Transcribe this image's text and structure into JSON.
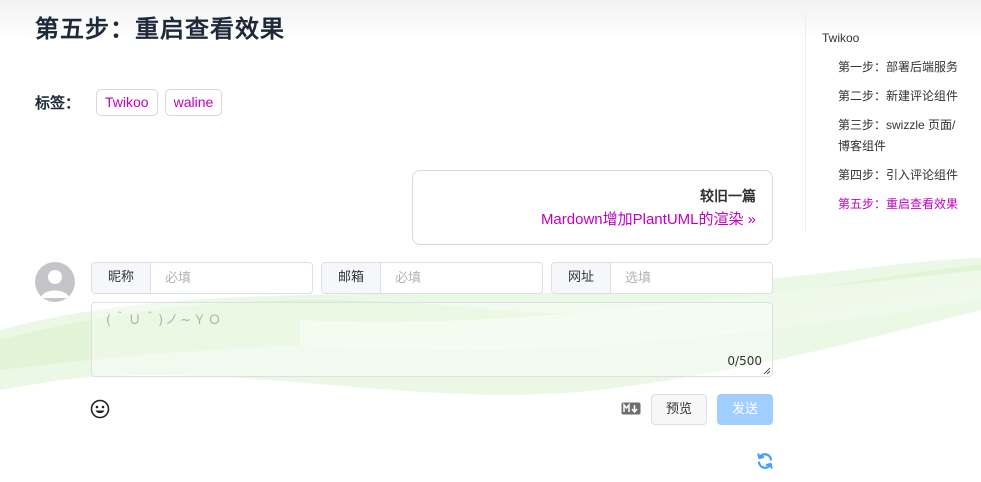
{
  "colors": {
    "accent": "#c000c0",
    "send_button": "#a0cfff",
    "refresh": "#409eff",
    "heading": "#1e2a3a"
  },
  "article": {
    "heading": "第五步：重启查看效果",
    "tags_label": "标签：",
    "tags": [
      "Twikoo",
      "waline"
    ]
  },
  "prev_post": {
    "label": "较旧一篇",
    "title": "Mardown增加PlantUML的渲染 »"
  },
  "toc": {
    "root": "Twikoo",
    "items": [
      "第一步：部署后端服务",
      "第二步：新建评论组件",
      "第三步：swizzle 页面/",
      "博客组件",
      "第四步：引入评论组件",
      "第五步：重启查看效果"
    ],
    "active_index": 5
  },
  "comment_form": {
    "avatar_icon": "user-avatar-icon",
    "fields": [
      {
        "label": "昵称",
        "placeholder": "必填",
        "value": ""
      },
      {
        "label": "邮箱",
        "placeholder": "必填",
        "value": ""
      },
      {
        "label": "网址",
        "placeholder": "选填",
        "value": ""
      }
    ],
    "textarea_placeholder": "(＾Ｕ＾)ノ~ＹＯ",
    "counter": "0/500",
    "emoji_icon": "smiley-icon",
    "markdown_icon": "markdown-icon",
    "preview_label": "预览",
    "send_label": "发送",
    "refresh_icon": "refresh-icon"
  }
}
